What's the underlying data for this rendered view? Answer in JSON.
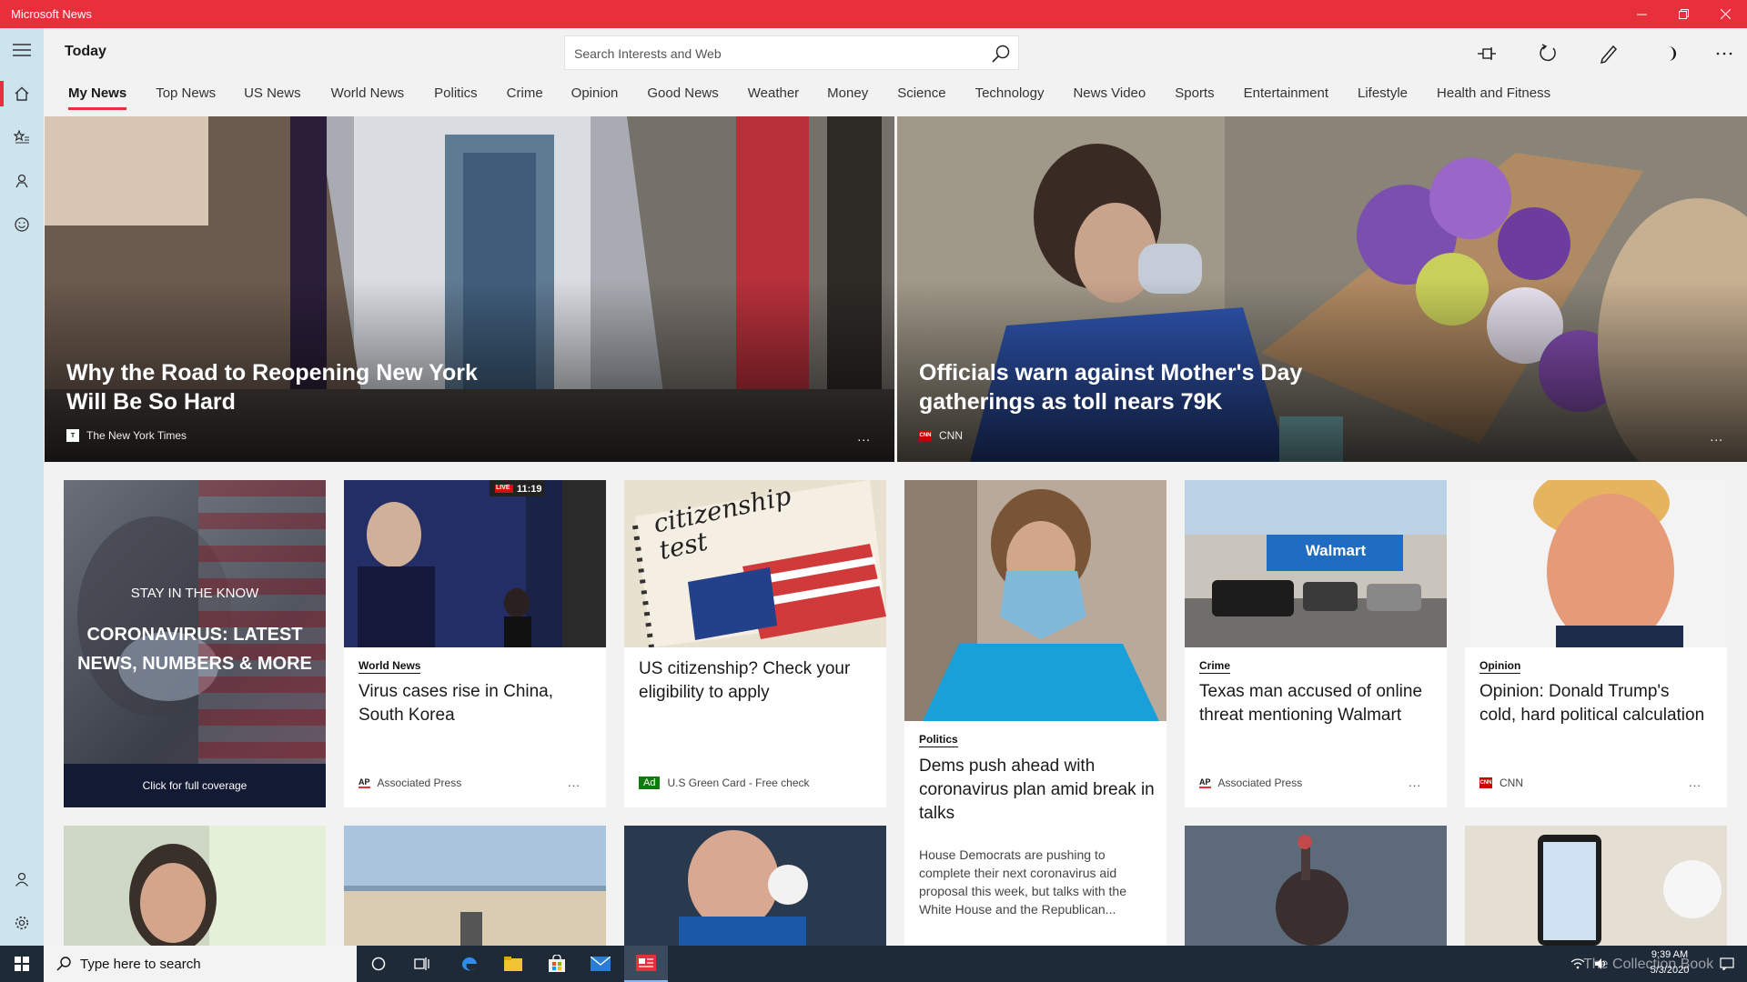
{
  "window": {
    "title": "Microsoft News"
  },
  "header": {
    "page_title": "Today",
    "search_placeholder": "Search Interests and Web"
  },
  "tabs": [
    {
      "label": "My News"
    },
    {
      "label": "Top News"
    },
    {
      "label": "US News"
    },
    {
      "label": "World News"
    },
    {
      "label": "Politics"
    },
    {
      "label": "Crime"
    },
    {
      "label": "Opinion"
    },
    {
      "label": "Good News"
    },
    {
      "label": "Weather"
    },
    {
      "label": "Money"
    },
    {
      "label": "Science"
    },
    {
      "label": "Technology"
    },
    {
      "label": "News Video"
    },
    {
      "label": "Sports"
    },
    {
      "label": "Entertainment"
    },
    {
      "label": "Lifestyle"
    },
    {
      "label": "Health and Fitness"
    }
  ],
  "hero": [
    {
      "headline": "Why the Road to Reopening New York Will Be So Hard",
      "source": "The New York Times",
      "more": "..."
    },
    {
      "headline": "Officials warn against Mother's Day gatherings as toll nears 79K",
      "source": "CNN",
      "more": "..."
    }
  ],
  "feature": {
    "kicker": "STAY IN THE KNOW",
    "headline": "CORONAVIRUS: LATEST NEWS, NUMBERS & MORE",
    "cta": "Click for full coverage"
  },
  "cards": [
    {
      "category": "World News",
      "title": "Virus cases rise in China, South Korea",
      "source": "Associated Press",
      "more": "...",
      "tv_time": "11:19",
      "tv_live": "LIVE",
      "ap": "AP"
    },
    {
      "title": "US citizenship? Check your eligibility to apply",
      "ad_label": "Ad",
      "source": "U.S Green Card - Free check",
      "note_text": "citizenship test"
    },
    {
      "category": "Politics",
      "title": "Dems push ahead with coronavirus plan amid break in talks",
      "description": "House Democrats are pushing to complete their next coronavirus aid proposal this week, but talks with the White House and the Republican..."
    },
    {
      "category": "Crime",
      "title": "Texas man accused of online threat mentioning Walmart",
      "source": "Associated Press",
      "more": "...",
      "store_sign": "Walmart",
      "ap": "AP"
    },
    {
      "category": "Opinion",
      "title": "Opinion: Donald Trump's cold, hard political calculation",
      "source": "CNN",
      "more": "..."
    }
  ],
  "taskbar": {
    "search_placeholder": "Type here to search",
    "time": "9:39 AM",
    "date": "5/3/2020",
    "watermark": "The Collection Book"
  },
  "colors": {
    "accent": "#e8303c",
    "rail": "#cde4ef",
    "taskbar": "#1f2a38"
  }
}
